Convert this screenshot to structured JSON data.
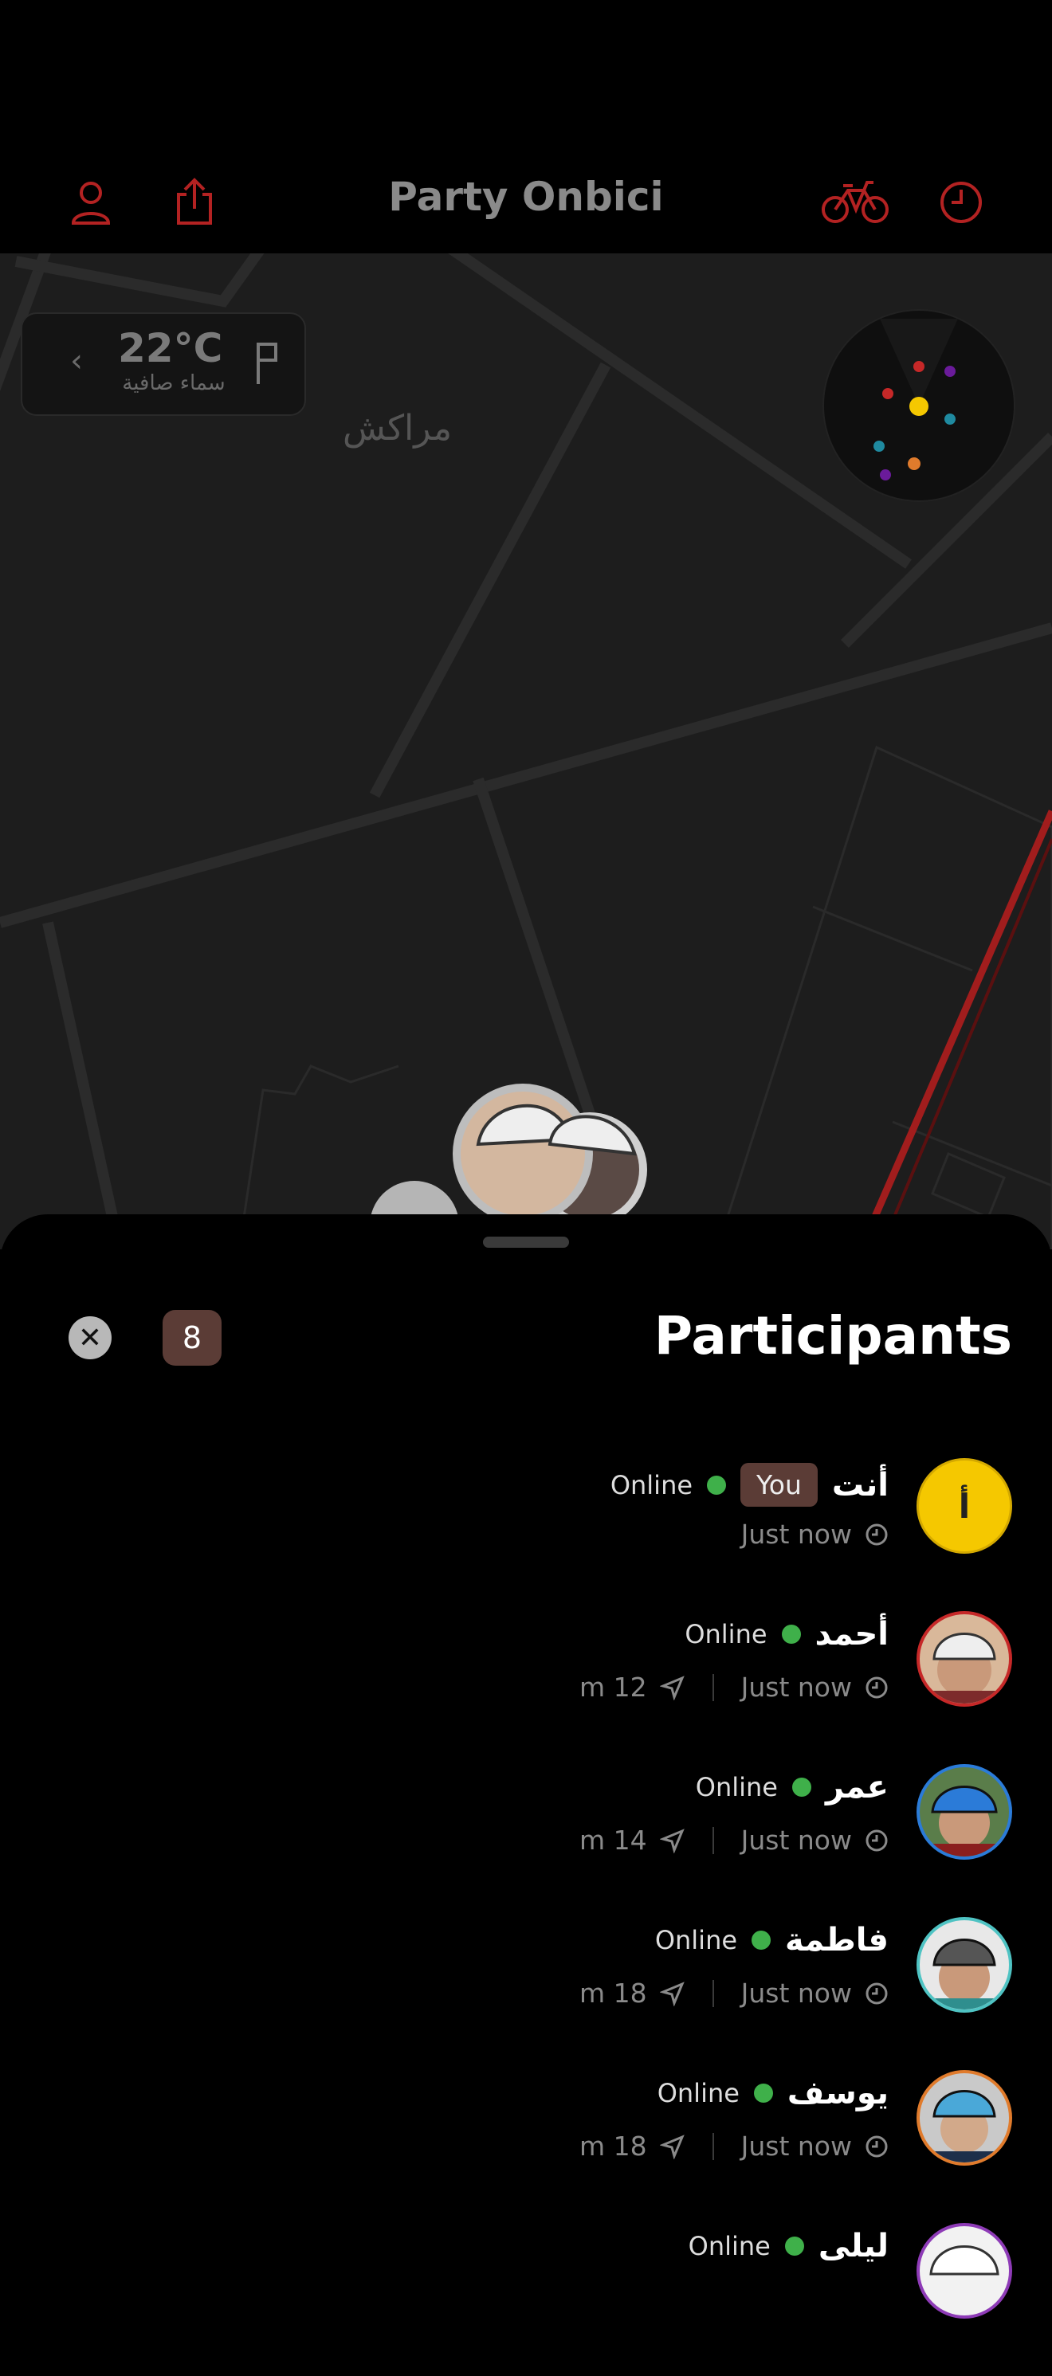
{
  "header": {
    "title": "Party Onbici",
    "icons": [
      "person-icon",
      "share-icon",
      "bike-icon",
      "clock-icon"
    ],
    "accent": "#b32222"
  },
  "map": {
    "city": "مراكش",
    "weather": {
      "temperature": "22°C",
      "description": "سماء صافية"
    },
    "route_color": "#a11d1d"
  },
  "sheet": {
    "title": "Participants",
    "count": "8",
    "participants": [
      {
        "name": "أنت",
        "initial": "أ",
        "badge": "You",
        "status": "Online",
        "time": "Just now",
        "distance": "",
        "ring": "#f5c800"
      },
      {
        "name": "أحمد",
        "status": "Online",
        "time": "Just now",
        "distance": "m 12",
        "ring": "#c62828"
      },
      {
        "name": "عمر",
        "status": "Online",
        "time": "Just now",
        "distance": "m 14",
        "ring": "#2b7bd8"
      },
      {
        "name": "فاطمة",
        "status": "Online",
        "time": "Just now",
        "distance": "m 18",
        "ring": "#4fc3c3"
      },
      {
        "name": "يوسف",
        "status": "Online",
        "time": "Just now",
        "distance": "m 18",
        "ring": "#e07b2c"
      },
      {
        "name": "ليلى",
        "status": "Online",
        "time": "",
        "distance": "",
        "ring": "#8e3bb7"
      }
    ]
  }
}
